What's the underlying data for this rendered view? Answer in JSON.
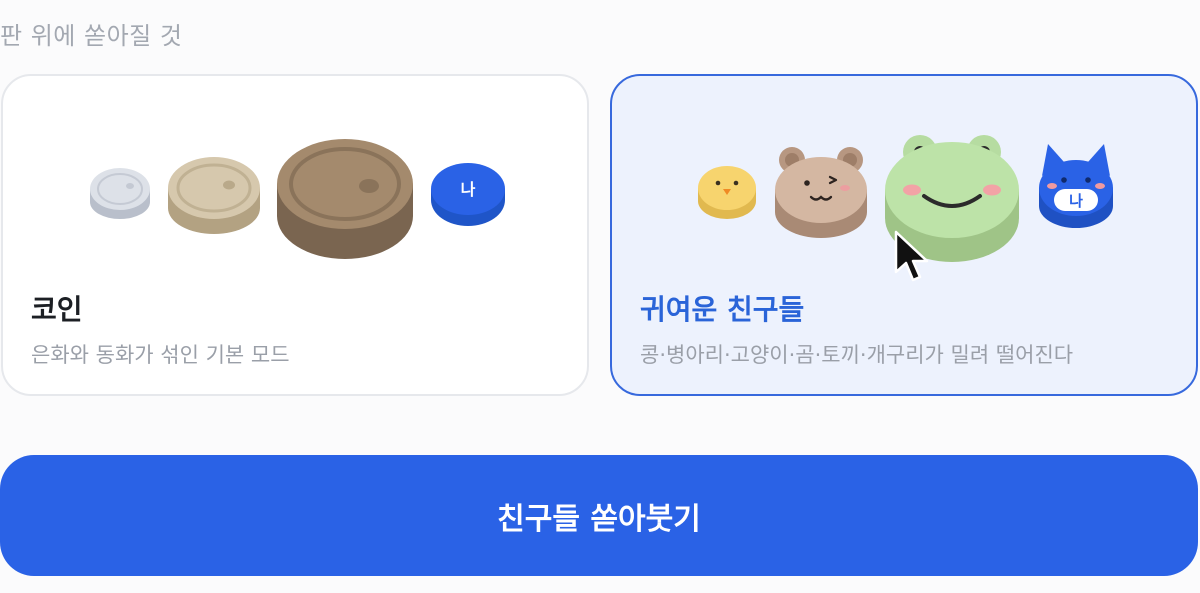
{
  "section": {
    "label": "판 위에 쏟아질 것"
  },
  "options": [
    {
      "title": "코인",
      "description": "은화와 동화가 섞인 기본 모드",
      "selected": false,
      "icons": [
        "silver-coin-icon",
        "bronze-coin-icon",
        "large-bronze-coin-icon",
        "me-chip-icon"
      ],
      "me_label": "나"
    },
    {
      "title": "귀여운 친구들",
      "description": "콩·병아리·고양이·곰·토끼·개구리가 밀려 떨어진다",
      "selected": true,
      "icons": [
        "chick-icon",
        "bear-icon",
        "frog-icon",
        "blue-cat-icon"
      ],
      "me_label": "나"
    }
  ],
  "cta": {
    "label": "친구들 쏟아붓기"
  },
  "colors": {
    "accent": "#2a62e6",
    "selected_border": "#3769dd",
    "selected_bg": "#edf2fd"
  }
}
